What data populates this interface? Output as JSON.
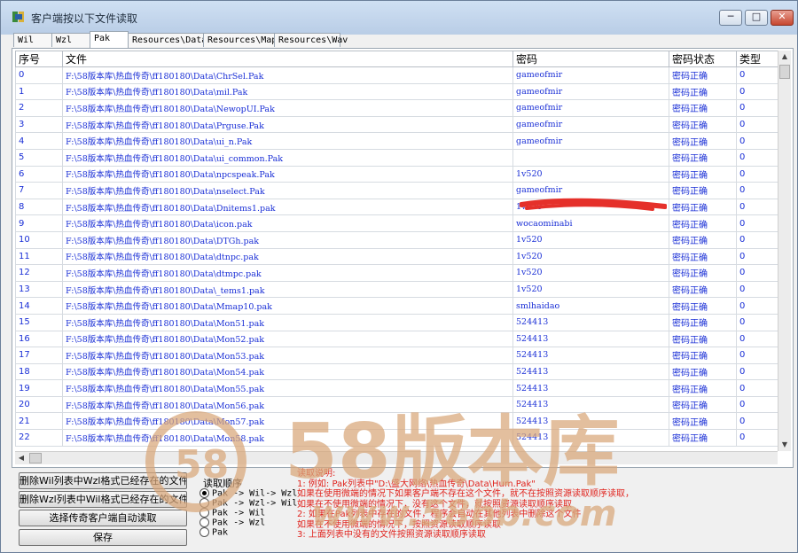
{
  "window": {
    "title": "客户端按以下文件读取"
  },
  "tabs": [
    "Wil",
    "Wzl",
    "Pak",
    "Resources\\Data",
    "Resources\\Map",
    "Resources\\Wav"
  ],
  "active_tab": "Pak",
  "table": {
    "columns": [
      "序号",
      "文件",
      "密码",
      "密码状态",
      "类型"
    ],
    "rows": [
      [
        "0",
        "F:\\58版本库\\热血传奇\\ff180180\\Data\\ChrSel.Pak",
        "gameofmir",
        "密码正确",
        "0"
      ],
      [
        "1",
        "F:\\58版本库\\热血传奇\\ff180180\\Data\\mil.Pak",
        "gameofmir",
        "密码正确",
        "0"
      ],
      [
        "2",
        "F:\\58版本库\\热血传奇\\ff180180\\Data\\NewopUI.Pak",
        "gameofmir",
        "密码正确",
        "0"
      ],
      [
        "3",
        "F:\\58版本库\\热血传奇\\ff180180\\Data\\Prguse.Pak",
        "gameofmir",
        "密码正确",
        "0"
      ],
      [
        "4",
        "F:\\58版本库\\热血传奇\\ff180180\\Data\\ui_n.Pak",
        "gameofmir",
        "密码正确",
        "0"
      ],
      [
        "5",
        "F:\\58版本库\\热血传奇\\ff180180\\Data\\ui_common.Pak",
        "",
        "密码正确",
        "0"
      ],
      [
        "6",
        "F:\\58版本库\\热血传奇\\ff180180\\Data\\npcspeak.Pak",
        "1v520",
        "密码正确",
        "0"
      ],
      [
        "7",
        "F:\\58版本库\\热血传奇\\ff180180\\Data\\nselect.Pak",
        "gameofmir",
        "密码正确",
        "0"
      ],
      [
        "8",
        "F:\\58版本库\\热血传奇\\ff180180\\Data\\Dnitems1.pak",
        "1v520",
        "密码正确",
        "0"
      ],
      [
        "9",
        "F:\\58版本库\\热血传奇\\ff180180\\Data\\icon.pak",
        "wocaominabi",
        "密码正确",
        "0"
      ],
      [
        "10",
        "F:\\58版本库\\热血传奇\\ff180180\\Data\\DTGh.pak",
        "1v520",
        "密码正确",
        "0"
      ],
      [
        "11",
        "F:\\58版本库\\热血传奇\\ff180180\\Data\\dtnpc.pak",
        "1v520",
        "密码正确",
        "0"
      ],
      [
        "12",
        "F:\\58版本库\\热血传奇\\ff180180\\Data\\dtmpc.pak",
        "1v520",
        "密码正确",
        "0"
      ],
      [
        "13",
        "F:\\58版本库\\热血传奇\\ff180180\\Data\\_tems1.pak",
        "1v520",
        "密码正确",
        "0"
      ],
      [
        "14",
        "F:\\58版本库\\热血传奇\\ff180180\\Data\\Mmap10.pak",
        "smlhaidao",
        "密码正确",
        "0"
      ],
      [
        "15",
        "F:\\58版本库\\热血传奇\\ff180180\\Data\\Mon51.pak",
        "524413",
        "密码正确",
        "0"
      ],
      [
        "16",
        "F:\\58版本库\\热血传奇\\ff180180\\Data\\Mon52.pak",
        "524413",
        "密码正确",
        "0"
      ],
      [
        "17",
        "F:\\58版本库\\热血传奇\\ff180180\\Data\\Mon53.pak",
        "524413",
        "密码正确",
        "0"
      ],
      [
        "18",
        "F:\\58版本库\\热血传奇\\ff180180\\Data\\Mon54.pak",
        "524413",
        "密码正确",
        "0"
      ],
      [
        "19",
        "F:\\58版本库\\热血传奇\\ff180180\\Data\\Mon55.pak",
        "524413",
        "密码正确",
        "0"
      ],
      [
        "20",
        "F:\\58版本库\\热血传奇\\ff180180\\Data\\Mon56.pak",
        "524413",
        "密码正确",
        "0"
      ],
      [
        "21",
        "F:\\58版本库\\热血传奇\\ff180180\\Data\\Mon57.pak",
        "524413",
        "密码正确",
        "0"
      ],
      [
        "22",
        "F:\\58版本库\\热血传奇\\ff180180\\Data\\Mon58.pak",
        "524413",
        "密码正确",
        "0"
      ]
    ]
  },
  "buttons": {
    "delete_wil": "删除Wil列表中Wzl格式已经存在的文件",
    "delete_wzl": "删除Wzl列表中Wil格式已经存在的文件",
    "select_client": "选择传奇客户端自动读取",
    "save": "保存"
  },
  "read_order": {
    "title": "读取顺序",
    "options": [
      "Pak -> Wil-> Wzl",
      "Pak -> Wzl-> Wil",
      "Pak -> Wil",
      "Pak -> Wzl",
      "Pak"
    ],
    "selected": 0
  },
  "notes": [
    "读取说明:",
    "1: 例如: Pak列表中\"D:\\盛大网络\\热血传奇\\Data\\Hum.Pak\"",
    "   如果在使用微端的情况下如果客户端不存在这个文件，就不在按照资源读取顺序读取，",
    "   如果在不使用微端的情况下，没有这个文件，就按照资源读取顺序读取",
    "2: 如果在Pak列表中存在的文件，程序会自动在其他列表中删除这个文件",
    "   如果在不使用微端的情况下，按照资源读取顺序读取",
    "3: 上面列表中没有的文件按照资源读取顺序读取"
  ],
  "watermark": {
    "text": "58版本库",
    "url": "www.58bb.com",
    "badge": "58"
  },
  "colors": {
    "link": "#1a2fd6",
    "note": "#e0241e",
    "watermark": "#d9a77a",
    "redact": "#e5302a"
  },
  "icons": [
    "app-icon",
    "minimize-icon",
    "maximize-icon",
    "close-icon",
    "scroll-up-icon",
    "scroll-down-icon",
    "scroll-left-icon"
  ]
}
